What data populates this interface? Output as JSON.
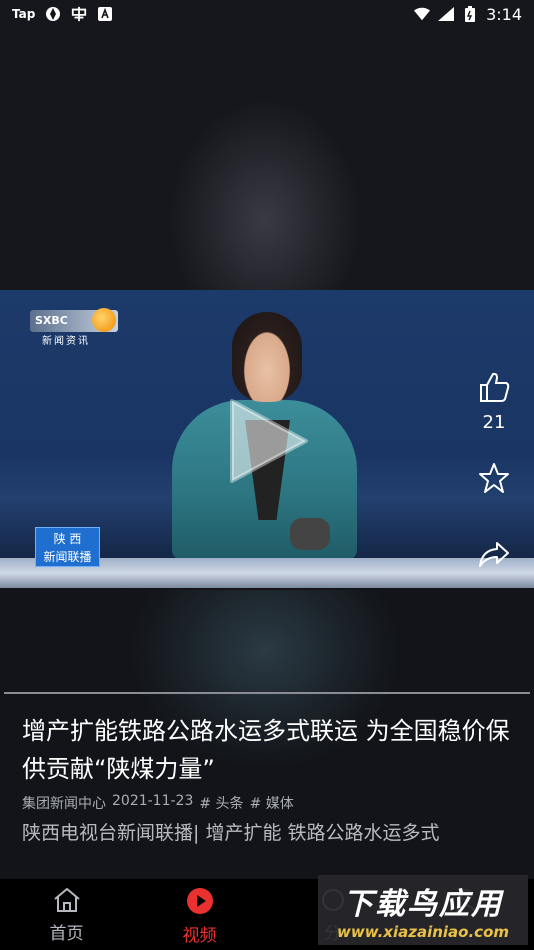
{
  "status_bar": {
    "left_items": [
      "Tap",
      "app-icon",
      "app-icon-2",
      "A"
    ],
    "time": "3:14"
  },
  "video": {
    "channel_logo": "SXBC",
    "channel_sub": "新闻资讯",
    "badge_line1": "陕 西",
    "badge_line2": "新闻联播",
    "like_count": "21"
  },
  "article": {
    "title": "增产扩能铁路公路水运多式联运 为全国稳价保供贡献“陕煤力量”",
    "source": "集团新闻中心",
    "date": "2021-11-23",
    "tags": [
      "# 头条",
      "# 媒体"
    ],
    "summary": "陕西电视台新闻联播| 增产扩能 铁路公路水运多式"
  },
  "bottom_nav": {
    "items": [
      {
        "label": "首页",
        "icon": "home-icon",
        "active": false
      },
      {
        "label": "视频",
        "icon": "video-play-icon",
        "active": true
      },
      {
        "label": "分",
        "icon": "share-icon",
        "active": false
      },
      {
        "label": "",
        "icon": "profile-icon",
        "active": false
      }
    ]
  },
  "watermark": {
    "main": "下载鸟应用",
    "url": "www.xiazainiao.com"
  },
  "colors": {
    "accent": "#e9322f",
    "background": "#14151a"
  }
}
